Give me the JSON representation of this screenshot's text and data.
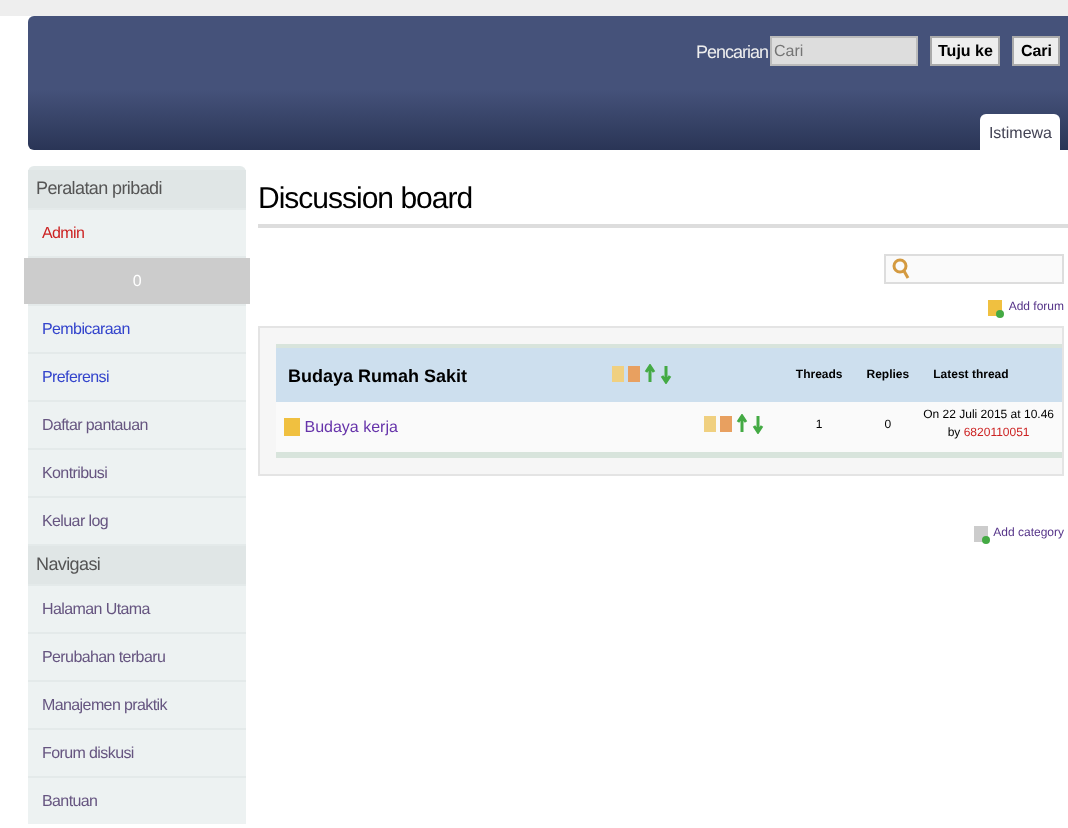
{
  "header": {
    "search_label": "Pencarian",
    "search_field": {
      "placeholder": "Cari"
    },
    "buttons": [
      "Tuju ke",
      "Cari"
    ],
    "tab": {
      "label": "Istimewa",
      "selected": true
    }
  },
  "sidebar": {
    "items": [
      {
        "kind": "heading",
        "label": "Peralatan pribadi"
      },
      {
        "kind": "user",
        "label": "Admin"
      },
      {
        "kind": "counter",
        "label": "0"
      },
      {
        "kind": "new_link",
        "label": "Pembicaraan"
      },
      {
        "kind": "new_link",
        "label": "Preferensi"
      },
      {
        "kind": "link",
        "label": "Daftar pantauan"
      },
      {
        "kind": "link",
        "label": "Kontribusi"
      },
      {
        "kind": "link",
        "label": "Keluar log"
      },
      {
        "kind": "heading",
        "label": "Navigasi"
      },
      {
        "kind": "link",
        "label": "Halaman Utama"
      },
      {
        "kind": "link",
        "label": "Perubahan terbaru"
      },
      {
        "kind": "link",
        "label": "Manajemen praktik"
      },
      {
        "kind": "link",
        "label": "Forum diskusi"
      },
      {
        "kind": "link",
        "label": "Bantuan"
      }
    ]
  },
  "page": {
    "title": "Discussion board",
    "add_forum": "Add forum",
    "add_category": "Add category",
    "category": {
      "name": "Budaya Rumah Sakit",
      "columns": [
        "Threads",
        "Replies",
        "Latest thread"
      ],
      "forums": [
        {
          "name": "Budaya kerja",
          "threads": "1",
          "replies": "0",
          "latest": "On 22 Juli 2015 at 10.46",
          "by": "by",
          "user": "6820110051"
        }
      ]
    }
  }
}
